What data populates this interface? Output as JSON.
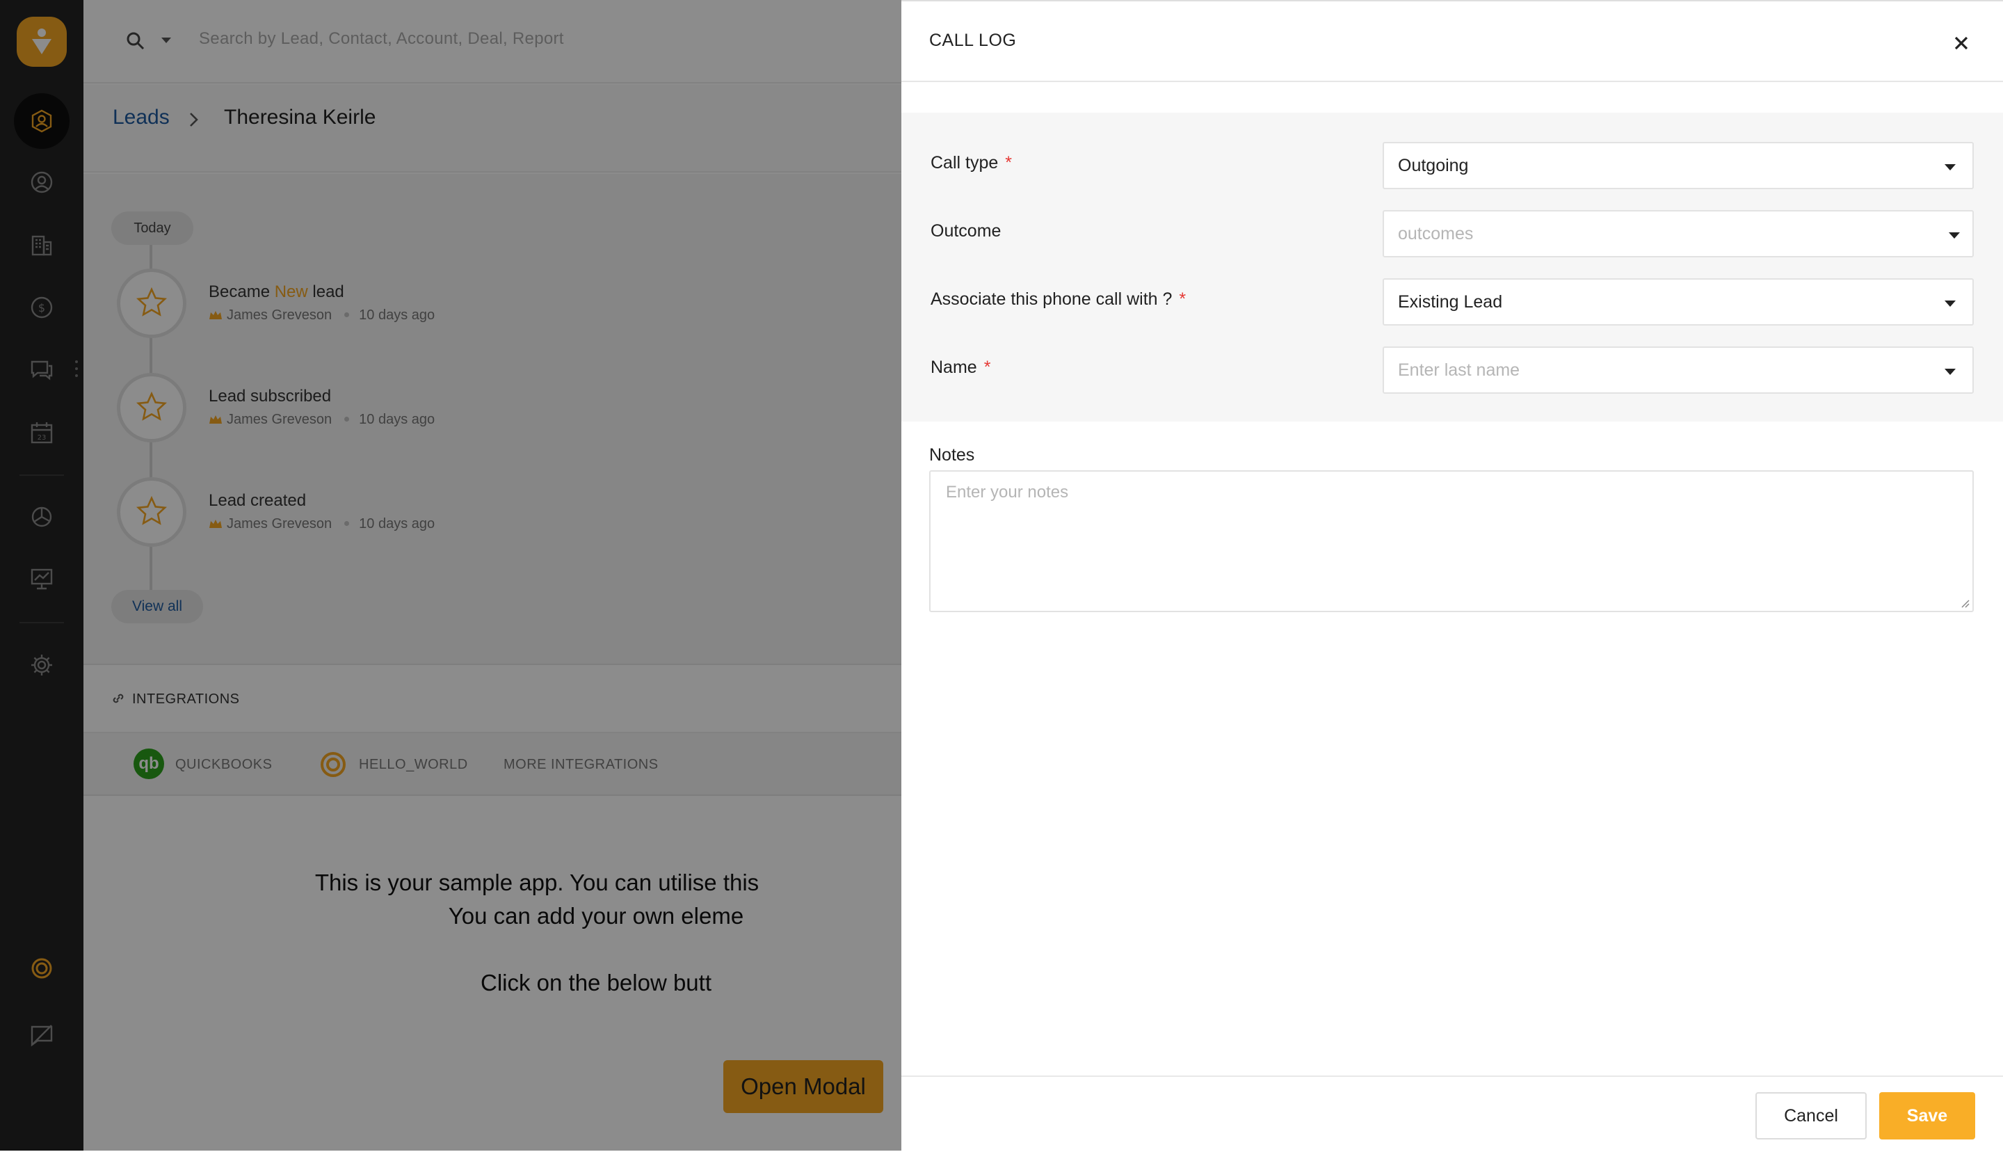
{
  "colors": {
    "accent": "#f5a623",
    "rail_bg": "#232323",
    "link": "#1e5a9e",
    "required": "#e53935",
    "save_button": "#f9ae27",
    "quickbooks": "#2ca01c"
  },
  "rail": {
    "logo_icon": "brand-logo-icon",
    "items": [
      {
        "icon": "leads-icon",
        "active": true
      },
      {
        "icon": "contacts-icon"
      },
      {
        "icon": "accounts-icon"
      },
      {
        "icon": "deals-icon"
      },
      {
        "icon": "messages-icon"
      },
      {
        "icon": "calendar-icon"
      },
      {
        "icon": "reports-icon"
      },
      {
        "icon": "analytics-icon"
      },
      {
        "icon": "settings-icon"
      },
      {
        "icon": "app-integration-icon"
      },
      {
        "icon": "feedback-icon"
      }
    ]
  },
  "search": {
    "placeholder": "Search by Lead, Contact, Account, Deal, Report"
  },
  "breadcrumb": {
    "root": "Leads",
    "current": "Theresina Keirle"
  },
  "timeline": {
    "today_label": "Today",
    "items": [
      {
        "title_prefix": "Became ",
        "title_highlight": "New",
        "title_suffix": " lead",
        "user": "James Greveson",
        "time": "10 days ago"
      },
      {
        "title_prefix": "Lead subscribed",
        "title_highlight": "",
        "title_suffix": "",
        "user": "James Greveson",
        "time": "10 days ago"
      },
      {
        "title_prefix": "Lead created",
        "title_highlight": "",
        "title_suffix": "",
        "user": "James Greveson",
        "time": "10 days ago"
      }
    ],
    "view_all_label": "View all"
  },
  "integrations": {
    "title": "INTEGRATIONS",
    "tabs": [
      "QUICKBOOKS",
      "HELLO_WORLD",
      "MORE INTEGRATIONS"
    ],
    "qb_glyph": "qb"
  },
  "sample_app": {
    "line1": "This is your sample app. You can utilise this",
    "line2": "You can add your own eleme",
    "line3": "Click on the below butt",
    "open_modal_label": "Open Modal"
  },
  "call_log": {
    "title": "CALL LOG",
    "fields": {
      "call_type": {
        "label": "Call type",
        "required_mark": "*",
        "value": "Outgoing"
      },
      "outcome": {
        "label": "Outcome",
        "placeholder": "outcomes"
      },
      "associate": {
        "label": "Associate this phone call with ?",
        "required_mark": "*",
        "value": "Existing Lead"
      },
      "name": {
        "label": "Name",
        "required_mark": "*",
        "placeholder": "Enter last name"
      }
    },
    "notes": {
      "label": "Notes",
      "placeholder": "Enter your notes"
    },
    "cancel_label": "Cancel",
    "save_label": "Save"
  }
}
